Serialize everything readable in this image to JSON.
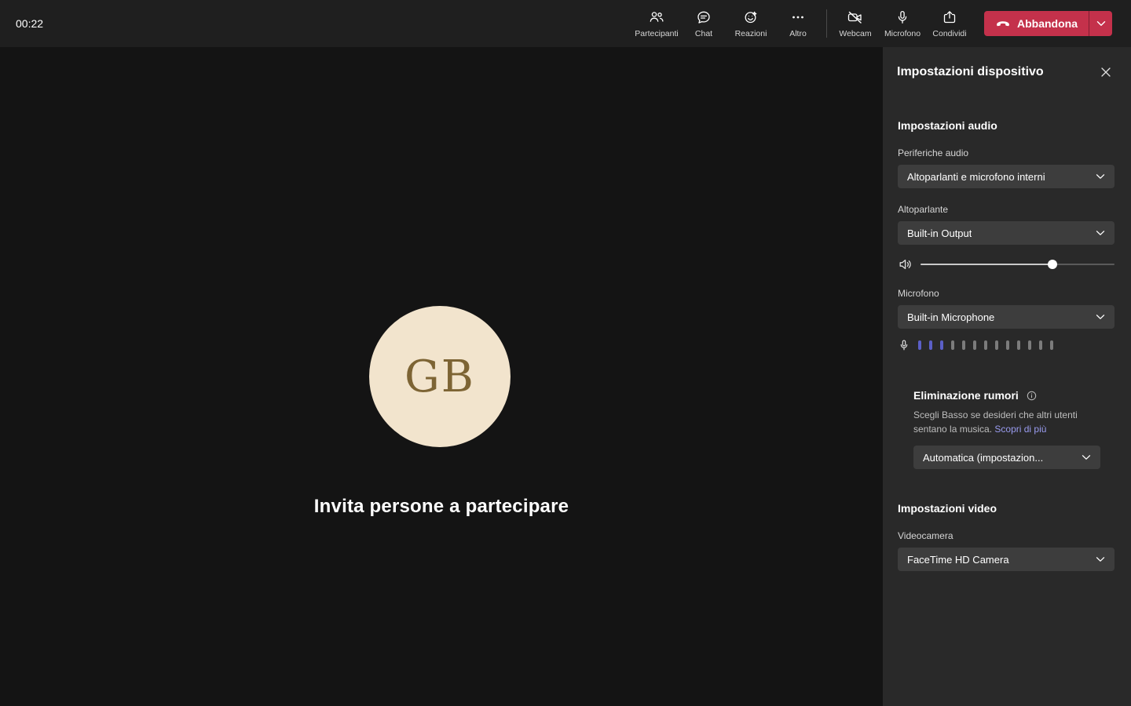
{
  "colors": {
    "leave_red": "#c4314b",
    "meter_active": "#5b5fc7",
    "link": "#9a9cf0",
    "avatar_bg": "#f2e4cd",
    "avatar_text": "#7d6434"
  },
  "topbar": {
    "timer": "00:22",
    "tools": [
      {
        "label": "Partecipanti"
      },
      {
        "label": "Chat"
      },
      {
        "label": "Reazioni"
      },
      {
        "label": "Altro"
      },
      {
        "label": "Webcam"
      },
      {
        "label": "Microfono"
      },
      {
        "label": "Condividi"
      }
    ],
    "leave_label": "Abbandona"
  },
  "stage": {
    "avatar_initials": "GB",
    "invite_text": "Invita persone a partecipare"
  },
  "panel": {
    "title": "Impostazioni dispositivo",
    "audio": {
      "section_title": "Impostazioni audio",
      "devices_label": "Periferiche audio",
      "devices_value": "Altoparlanti e microfono interni",
      "speaker_label": "Altoparlante",
      "speaker_value": "Built-in Output",
      "volume_percent": 68,
      "mic_label": "Microfono",
      "mic_value": "Built-in Microphone",
      "mic_meter": {
        "segments": 13,
        "active": 3
      },
      "noise_title": "Eliminazione rumori",
      "noise_desc": "Scegli Basso se desideri che altri utenti sentano la musica. ",
      "noise_link": "Scopri di più",
      "noise_value": "Automatica (impostazion..."
    },
    "video": {
      "section_title": "Impostazioni video",
      "camera_label": "Videocamera",
      "camera_value": "FaceTime HD Camera"
    }
  }
}
